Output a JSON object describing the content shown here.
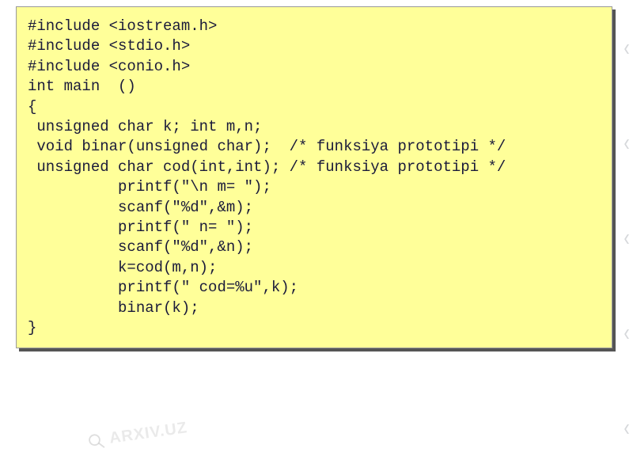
{
  "watermark": {
    "text": "ARXIV.UZ"
  },
  "code": {
    "lines": [
      "#include <iostream.h>",
      "#include <stdio.h>",
      "#include <conio.h>",
      "int main  ()",
      "{",
      " unsigned char k; int m,n;",
      " void binar(unsigned char);  /* funksiya prototipi */",
      " unsigned char cod(int,int); /* funksiya prototipi */",
      "          printf(\"\\n m= \");",
      "          scanf(\"%d\",&m);",
      "          printf(\" n= \");",
      "          scanf(\"%d\",&n);",
      "          k=cod(m,n);",
      "          printf(\" cod=%u\",k);",
      "          binar(k);",
      "}"
    ]
  }
}
